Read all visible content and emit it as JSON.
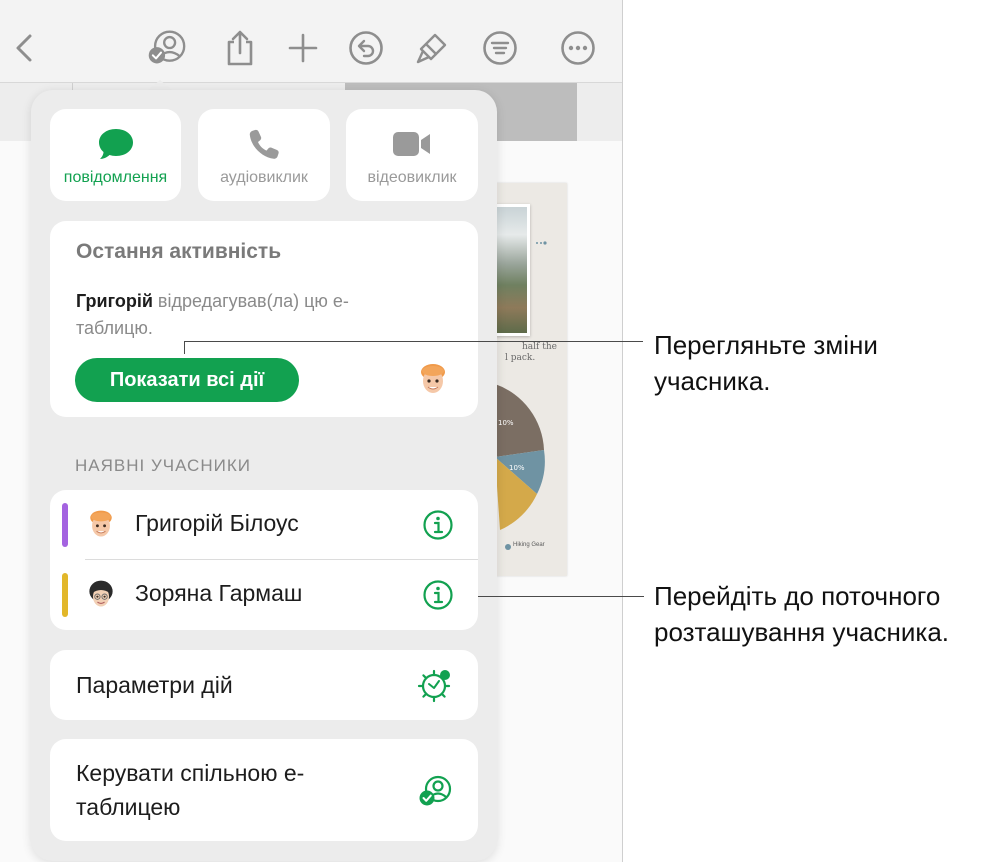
{
  "actions": [
    {
      "label": "повідомлення",
      "icon": "message-icon",
      "active": true
    },
    {
      "label": "аудіовиклик",
      "icon": "phone-icon",
      "active": false
    },
    {
      "label": "відеовиклик",
      "icon": "video-icon",
      "active": false
    }
  ],
  "recent_activity": {
    "title": "Остання активність",
    "actor": "Григорій",
    "action_text": " відредагував(ла) цю е-таблицю.",
    "show_all_button": "Показати всі дії"
  },
  "participants": {
    "header": "НАЯВНІ УЧАСНИКИ",
    "items": [
      {
        "name": "Григорій Білоус",
        "color": "#a463e0"
      },
      {
        "name": "Зоряна Гармаш",
        "color": "#e2b72a"
      }
    ]
  },
  "activity_settings": {
    "label": "Параметри дій"
  },
  "manage": {
    "label": "Керувати спільною е-таблицею"
  },
  "document": {
    "sheet_text": "half the",
    "sheet_text2": "l pack.",
    "pie_labels": [
      "10%",
      "10%"
    ],
    "legend": "Hiking Gear"
  },
  "callouts": {
    "top": "Перегляньте зміни учасника.",
    "bottom": "Перейдіть до поточного розташування учасника."
  },
  "colors": {
    "accent": "#12a150"
  }
}
